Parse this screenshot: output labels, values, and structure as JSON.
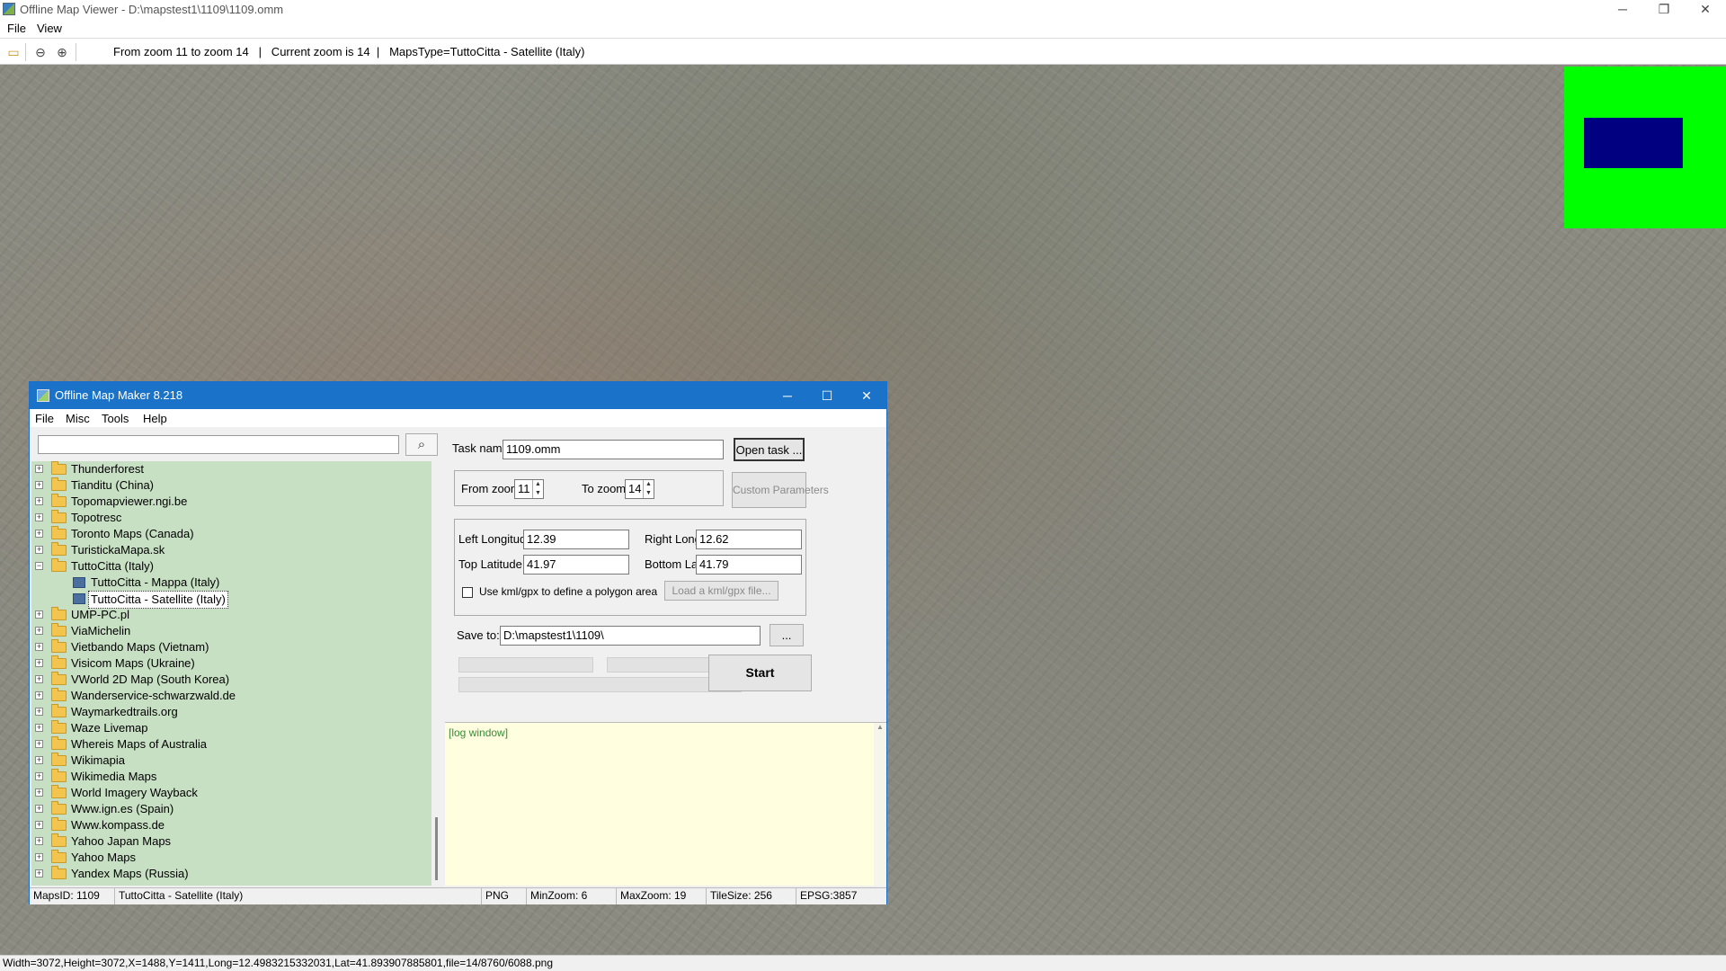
{
  "window": {
    "title": "Offline Map Viewer - D:\\mapstest1\\1109\\1109.omm",
    "controls": [
      "─",
      "❐",
      "✕"
    ]
  },
  "menu": [
    "File",
    "View"
  ],
  "toolbar": {
    "icons": [
      "open-folder-icon",
      "zoom-out-icon",
      "zoom-in-icon"
    ],
    "zoom_info": "From zoom 11 to zoom 14   |   Current zoom is 14  |   MapsType=TuttoCitta - Satellite (Italy)"
  },
  "overview": {
    "background": "#00ff00",
    "viewport_color": "#000080"
  },
  "statusbar": "Width=3072,Height=3072,X=1488,Y=1411,Long=12.4983215332031,Lat=41.893907885801,file=14/8760/6088.png",
  "dialog": {
    "title": "Offline Map Maker 8.218",
    "controls": [
      "─",
      "☐",
      "✕"
    ],
    "menu": [
      "File",
      "Misc",
      "Tools",
      "Help"
    ],
    "search": {
      "value": "",
      "button_icon": "⌕"
    },
    "tree": [
      {
        "label": "Thunderforest",
        "expanded": false
      },
      {
        "label": "Tianditu (China)",
        "expanded": false
      },
      {
        "label": "Topomapviewer.ngi.be",
        "expanded": false
      },
      {
        "label": "Topotresc",
        "expanded": false
      },
      {
        "label": "Toronto Maps (Canada)",
        "expanded": false
      },
      {
        "label": "TuristickaMapa.sk",
        "expanded": false
      },
      {
        "label": "TuttoCitta (Italy)",
        "expanded": true
      },
      {
        "label": "TuttoCitta - Mappa (Italy)",
        "child": true
      },
      {
        "label": "TuttoCitta - Satellite (Italy)",
        "child": true,
        "selected": true
      },
      {
        "label": "UMP-PC.pl",
        "expanded": false
      },
      {
        "label": "ViaMichelin",
        "expanded": false
      },
      {
        "label": "Vietbando Maps (Vietnam)",
        "expanded": false
      },
      {
        "label": "Visicom Maps (Ukraine)",
        "expanded": false
      },
      {
        "label": "VWorld 2D Map (South Korea)",
        "expanded": false
      },
      {
        "label": "Wanderservice-schwarzwald.de",
        "expanded": false
      },
      {
        "label": "Waymarkedtrails.org",
        "expanded": false
      },
      {
        "label": "Waze Livemap",
        "expanded": false
      },
      {
        "label": "Whereis Maps of Australia",
        "expanded": false
      },
      {
        "label": "Wikimapia",
        "expanded": false
      },
      {
        "label": "Wikimedia Maps",
        "expanded": false
      },
      {
        "label": "World Imagery Wayback",
        "expanded": false
      },
      {
        "label": "Www.ign.es (Spain)",
        "expanded": false
      },
      {
        "label": "Www.kompass.de",
        "expanded": false
      },
      {
        "label": "Yahoo Japan Maps",
        "expanded": false
      },
      {
        "label": "Yahoo Maps",
        "expanded": false
      },
      {
        "label": "Yandex Maps (Russia)",
        "expanded": false
      }
    ],
    "task": {
      "label": "Task name",
      "value": "1109.omm",
      "open_button": "Open task ..."
    },
    "zoom": {
      "from_label": "From zoom",
      "from_value": "11",
      "to_label": "To zoom",
      "to_value": "14",
      "custom_button": "Custom Parameters"
    },
    "area": {
      "left_lon_label": "Left Longitude",
      "left_lon": "12.39",
      "right_lon_label": "Right Longitude",
      "right_lon": "12.62",
      "top_lat_label": "Top Latitude",
      "top_lat": "41.97",
      "bottom_lat_label": "Bottom Latitude",
      "bottom_lat": "41.79",
      "kml_checkbox_label": "Use kml/gpx to define a polygon area",
      "kml_checked": false,
      "kml_button": "Load a kml/gpx file..."
    },
    "save": {
      "label": "Save to:",
      "value": "D:\\mapstest1\\1109\\",
      "browse": "..."
    },
    "start_button": "Start",
    "log": "[log window]",
    "status": {
      "maps_id": "MapsID: 1109",
      "map_name": "TuttoCitta - Satellite (Italy)",
      "format": "PNG",
      "min_zoom": "MinZoom: 6",
      "max_zoom": "MaxZoom: 19",
      "tile_size": "TileSize: 256",
      "epsg": "EPSG:3857"
    }
  }
}
